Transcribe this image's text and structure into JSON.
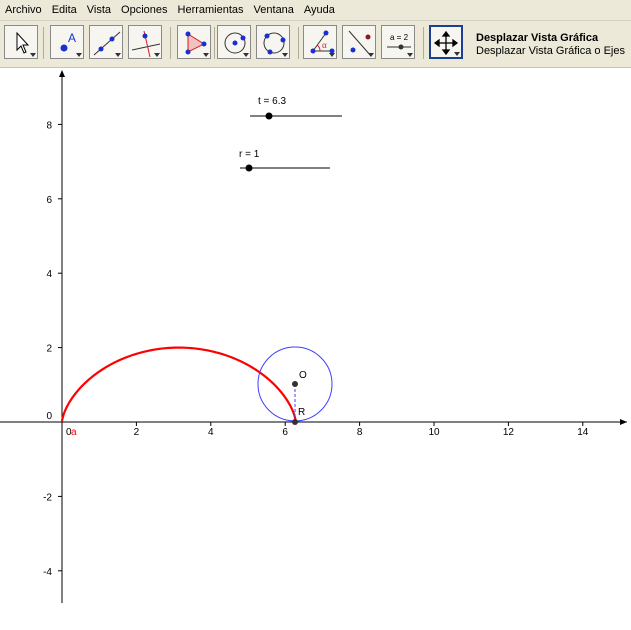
{
  "menu": [
    "Archivo",
    "Edita",
    "Vista",
    "Opciones",
    "Herramientas",
    "Ventana",
    "Ayuda"
  ],
  "toolbar": {
    "tools": [
      {
        "name": "move-tool",
        "icon": "cursor-arrow-icon"
      },
      {
        "name": "point-tool",
        "icon": "point-a-icon"
      },
      {
        "name": "line-tool",
        "icon": "line-through-points-icon"
      },
      {
        "name": "perpendicular-tool",
        "icon": "perpendicular-line-icon"
      },
      {
        "name": "polygon-tool",
        "icon": "polygon-icon"
      },
      {
        "name": "circle-center-point-tool",
        "icon": "circle-center-icon"
      },
      {
        "name": "circle-three-points-tool",
        "icon": "circle-three-points-icon"
      },
      {
        "name": "angle-tool",
        "icon": "angle-icon"
      },
      {
        "name": "reflect-tool",
        "icon": "reflect-about-line-icon"
      },
      {
        "name": "slider-tool",
        "icon": "slider-icon",
        "label": "a = 2"
      },
      {
        "name": "move-graphics-view-tool",
        "icon": "move-view-arrows-icon",
        "selected": true
      }
    ],
    "selected_title": "Desplazar Vista Gráfica",
    "selected_desc": "Desplazar Vista Gráfica o Ejes"
  },
  "graphics": {
    "x_ticks": [
      "2",
      "4",
      "6",
      "8",
      "10",
      "12",
      "14"
    ],
    "y_ticks": [
      "8",
      "6",
      "4",
      "2",
      "0",
      "-2",
      "-4"
    ],
    "origin_x_label": "0",
    "origin_x_sub": "a",
    "sliders": [
      {
        "label": "t = 6.3",
        "value": 6.3
      },
      {
        "label": "r = 1",
        "value": 1
      }
    ],
    "points": {
      "center_label": "O",
      "contact_label": "R"
    },
    "colors": {
      "curve": "#ff0000",
      "circle": "#4040ff",
      "axis": "#000000",
      "point": "#333333"
    }
  }
}
